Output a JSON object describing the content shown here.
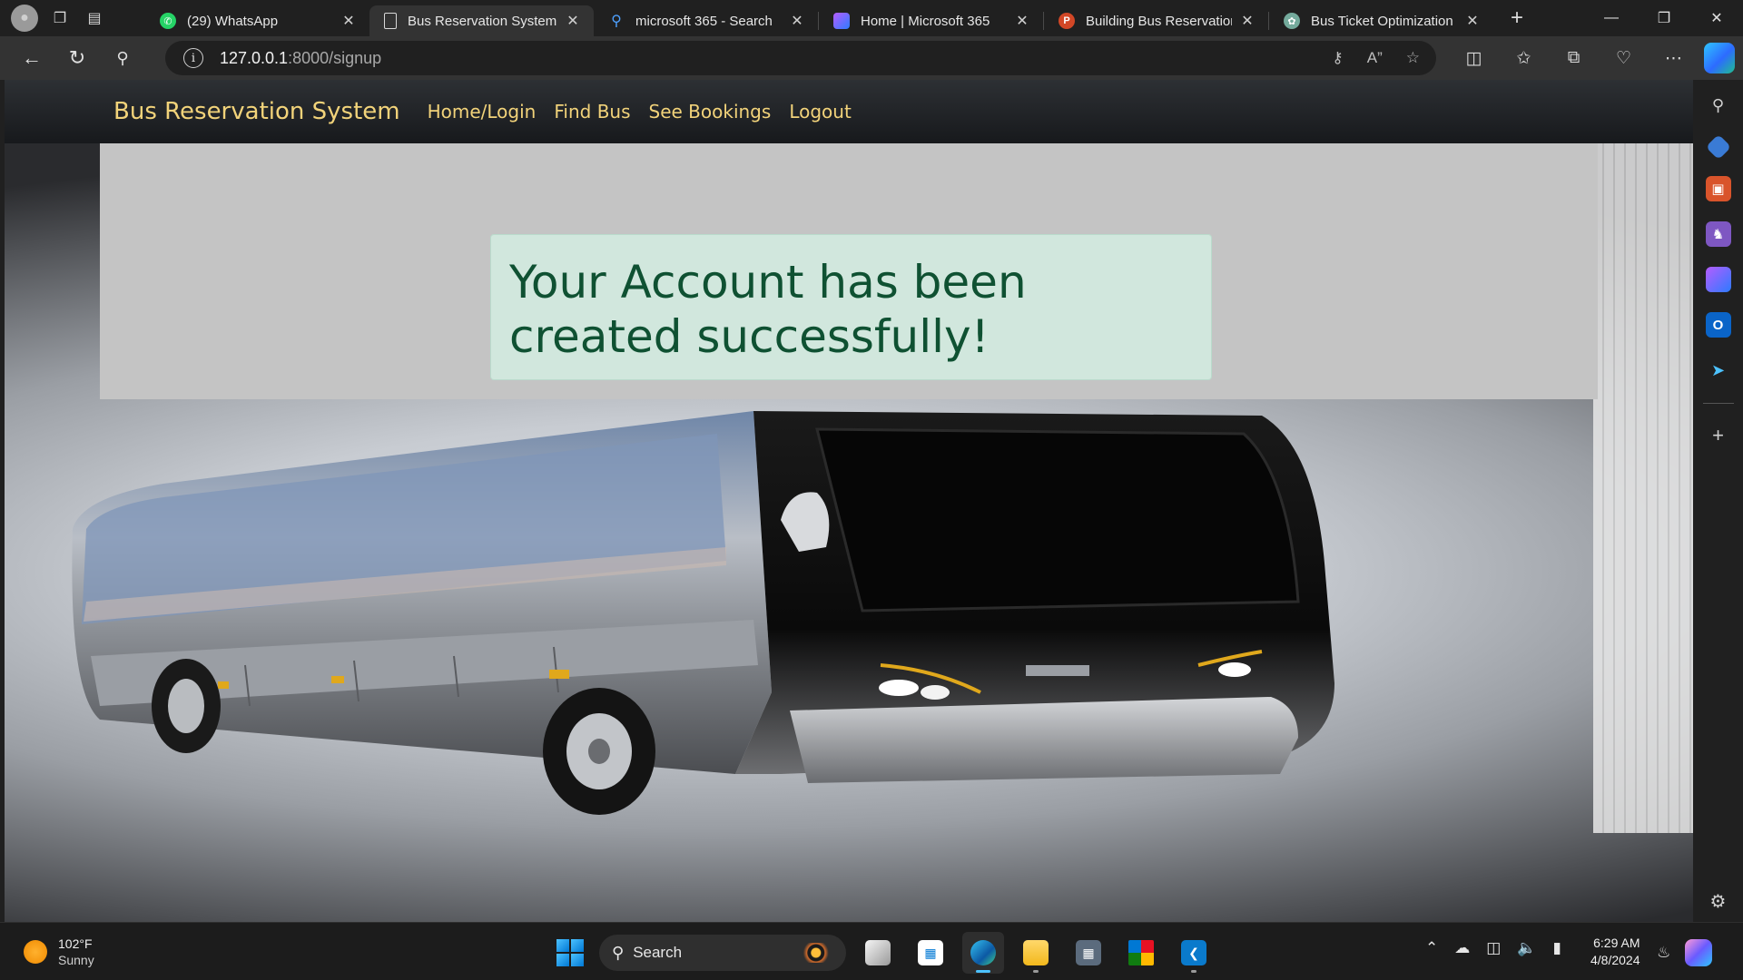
{
  "browser": {
    "tabs": [
      {
        "label": "(29) WhatsApp",
        "icon": "whatsapp-icon",
        "active": false
      },
      {
        "label": "Bus Reservation System in",
        "icon": "page-icon",
        "active": true
      },
      {
        "label": "microsoft 365 - Search",
        "icon": "search-icon",
        "active": false
      },
      {
        "label": "Home | Microsoft 365",
        "icon": "m365-icon",
        "active": false
      },
      {
        "label": "Building Bus Reservation",
        "icon": "powerpoint-icon",
        "active": false
      },
      {
        "label": "Bus Ticket Optimization S",
        "icon": "chatgpt-icon",
        "active": false
      }
    ],
    "url_host": "127.0.0.1",
    "url_path": ":8000/signup"
  },
  "page": {
    "brand": "Bus Reservation System",
    "nav_links": [
      "Home/Login",
      "Find Bus",
      "See Bookings",
      "Logout"
    ],
    "alert_message": "Your Account has been created successfully!"
  },
  "taskbar": {
    "weather_temp": "102°F",
    "weather_condition": "Sunny",
    "search_placeholder": "Search",
    "time": "6:29 AM",
    "date": "4/8/2024"
  },
  "colors": {
    "nav_link": "#f2d37a",
    "alert_bg": "#d1e7dd",
    "alert_text": "#0f5132",
    "panel_bg": "#c4c4c4"
  }
}
